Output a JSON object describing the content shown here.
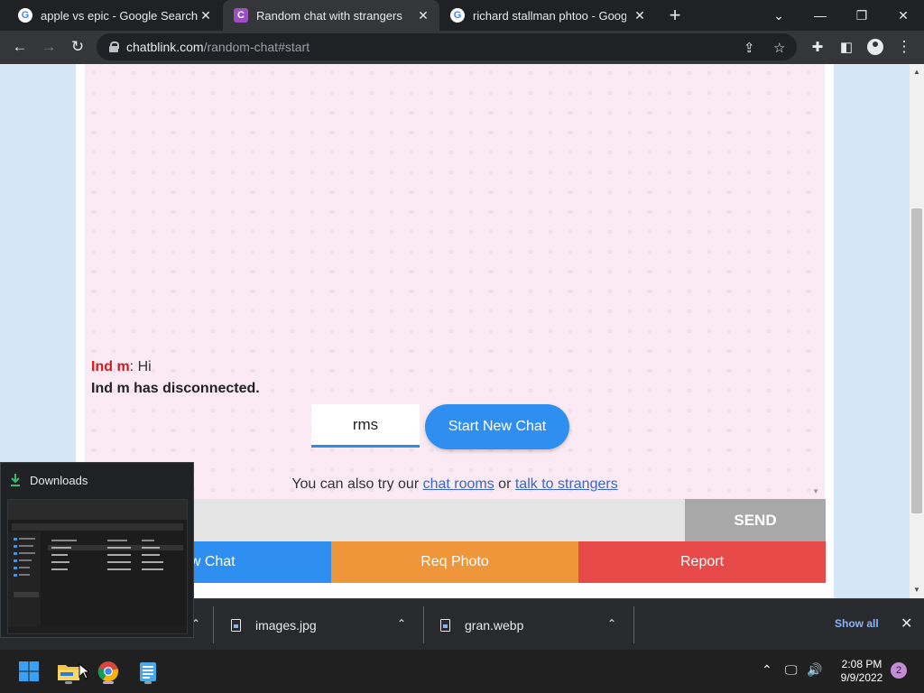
{
  "browser": {
    "tabs": [
      {
        "label": "apple vs epic - Google Search",
        "icon": "google-icon"
      },
      {
        "label": "Random chat with strangers",
        "icon": "chatblink-icon",
        "active": true
      },
      {
        "label": "richard stallman phtoo - Google",
        "icon": "google-icon"
      }
    ],
    "new_tab": "+",
    "url_host": "chatblink.com",
    "url_path": "/random-chat#start"
  },
  "chat": {
    "messages": [
      {
        "sender": "Ind m",
        "text": ": Hi"
      },
      {
        "system": "Ind m has disconnected."
      }
    ],
    "gender_input_value": "rms",
    "start_button": "Start New Chat",
    "also_try_prefix": "You can also try our ",
    "chat_rooms_link": "chat rooms",
    "or_text": " or ",
    "talk_link": "talk to strangers",
    "send_button": "SEND",
    "new_chat_button": "New Chat",
    "req_photo_button": "Req Photo",
    "report_button": "Report",
    "colors": {
      "blue": "#2e8ff0",
      "orange": "#f0963a",
      "red": "#e84a4a",
      "send": "#a8a8a8"
    }
  },
  "downloads_popup": {
    "title": "Downloads"
  },
  "shelf": {
    "items": [
      {
        "name": "images.jpg"
      },
      {
        "name": "gran.webp"
      }
    ],
    "show_all": "Show all"
  },
  "taskbar": {
    "time": "2:08 PM",
    "date": "9/9/2022",
    "notifications": "2"
  }
}
